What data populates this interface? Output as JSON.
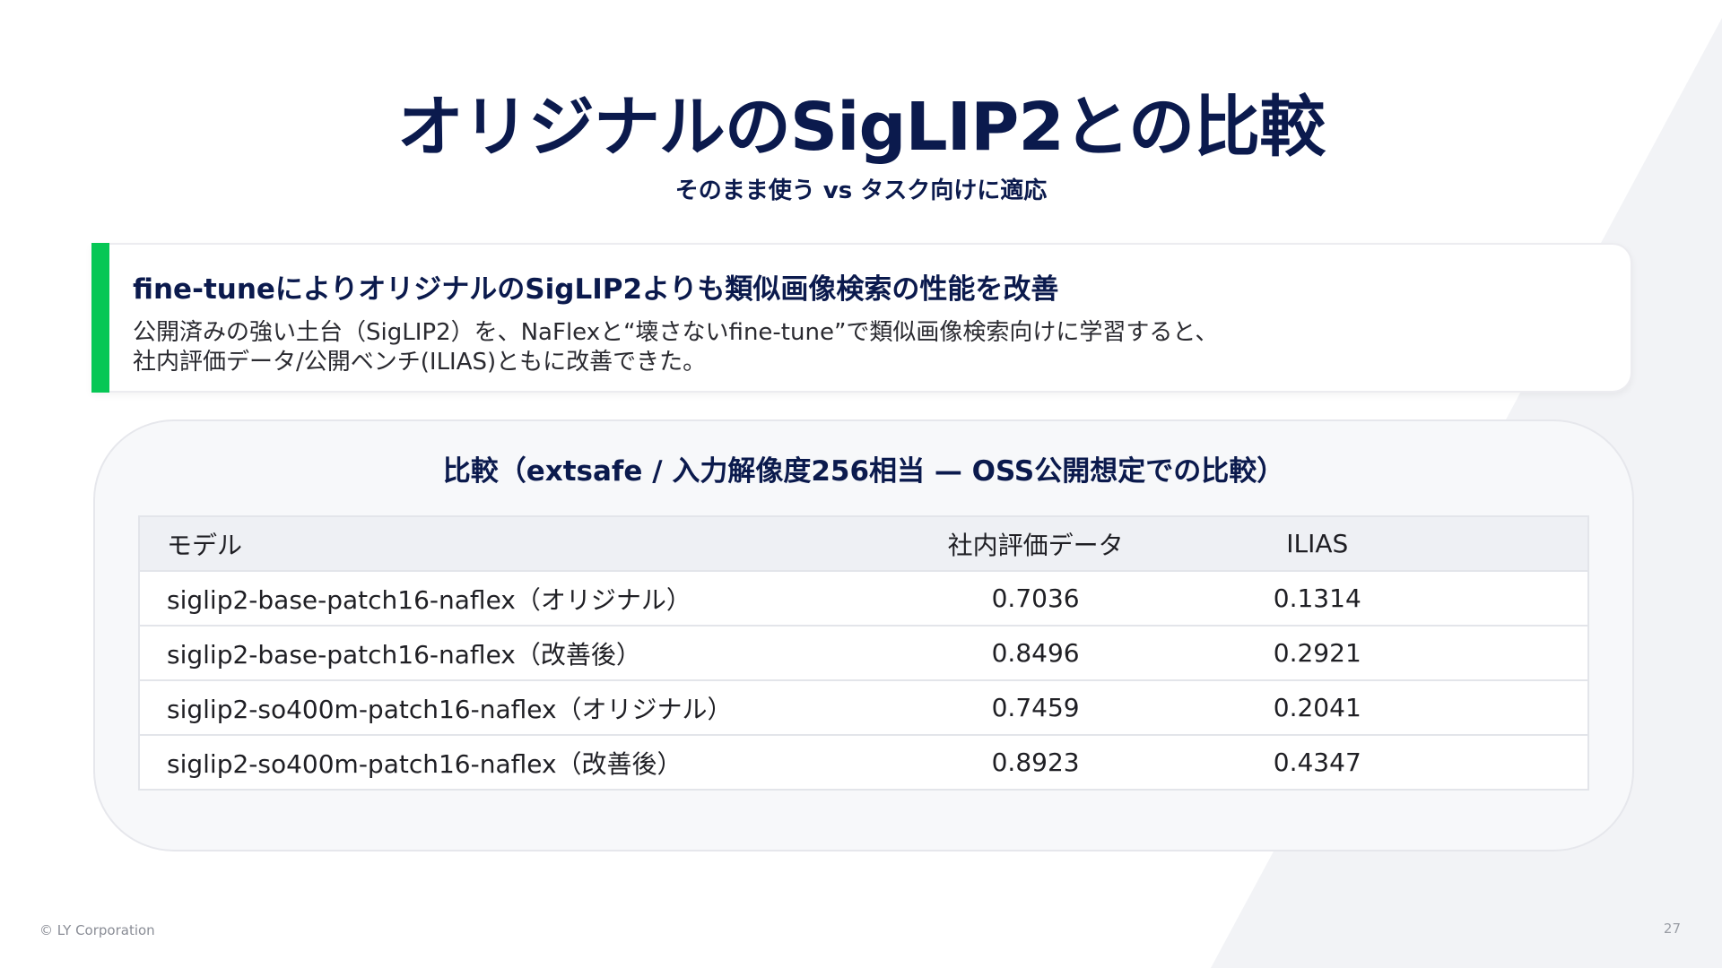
{
  "slide": {
    "title": "オリジナルのSigLIP2との比較",
    "subtitle": "そのまま使う vs タスク向けに適応"
  },
  "callout": {
    "heading": "fine-tuneによりオリジナルのSigLIP2よりも類似画像検索の性能を改善",
    "body_line1": "公開済みの強い土台（SigLIP2）を、NaFlexと“壊さないfine-tune”で類似画像検索向けに学習すると、",
    "body_line2": "社内評価データ/公開ベンチ(ILIAS)ともに改善できた。",
    "accent_color": "#06c755"
  },
  "comparison": {
    "title": "比較（extsafe / 入力解像度256相当 — OSS公開想定での比較）",
    "columns": [
      "モデル",
      "社内評価データ",
      "ILIAS"
    ],
    "rows": [
      {
        "model": "siglip2-base-patch16-naflex（オリジナル）",
        "internal": "0.7036",
        "ilias": "0.1314"
      },
      {
        "model": "siglip2-base-patch16-naflex（改善後）",
        "internal": "0.8496",
        "ilias": "0.2921"
      },
      {
        "model": "siglip2-so400m-patch16-naflex（オリジナル）",
        "internal": "0.7459",
        "ilias": "0.2041"
      },
      {
        "model": "siglip2-so400m-patch16-naflex（改善後）",
        "internal": "0.8923",
        "ilias": "0.4347"
      }
    ]
  },
  "footer": {
    "copyright": "© LY Corporation",
    "page_number": "27"
  },
  "colors": {
    "title": "#0b1a4d",
    "accent": "#06c755"
  }
}
